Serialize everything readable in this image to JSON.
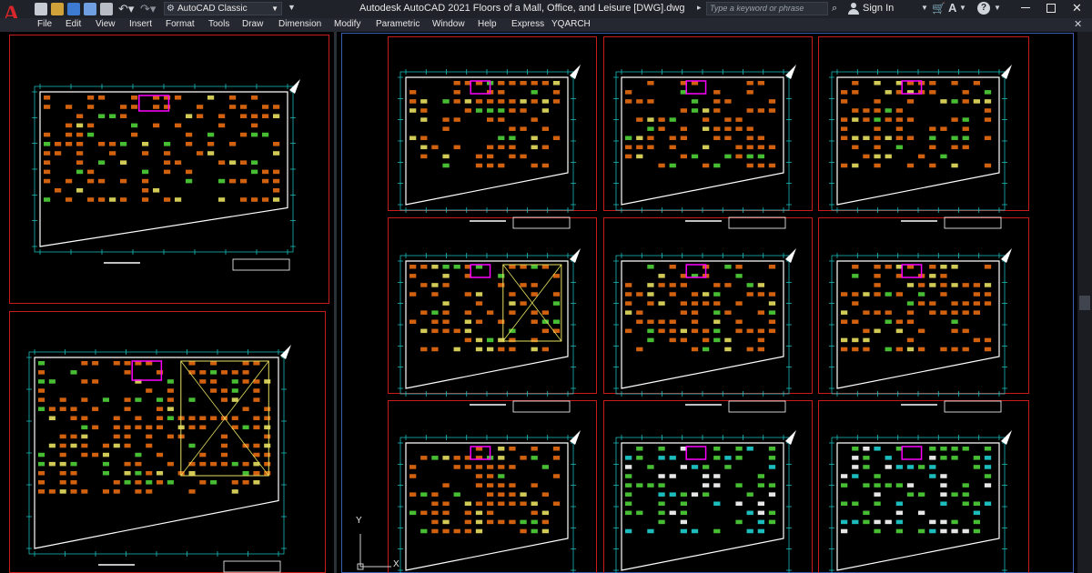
{
  "titlebar": {
    "app_logo": "A",
    "workspace": "AutoCAD Classic",
    "title": "Autodesk AutoCAD 2021    Floors of a Mall, Office, and Leisure [DWG].dwg",
    "search_placeholder": "Type a keyword or phrase",
    "signin_label": "Sign In",
    "icons": [
      "new-icon",
      "open-icon",
      "save-icon",
      "saveas-icon",
      "print-icon",
      "undo-icon",
      "redo-icon",
      "search-icon",
      "user-icon",
      "cart-icon",
      "a360-icon",
      "help-icon",
      "minimize-icon",
      "maximize-icon",
      "close-icon"
    ]
  },
  "menu": {
    "items": [
      "File",
      "Edit",
      "View",
      "Insert",
      "Format",
      "Tools",
      "Draw",
      "Dimension",
      "Modify",
      "Parametric",
      "Window",
      "Help",
      "Express",
      "YQARCH"
    ]
  },
  "drawing": {
    "ucs": {
      "y_label": "Y",
      "x_label": "X"
    },
    "colors": {
      "background": "#000000",
      "sheet_border": "#c81c1c",
      "dimension_line": "#1fd0d0",
      "walls": "#ffffff",
      "furniture": "#e86c10",
      "highlight": "#ff00ff",
      "ceiling_lines": "#e8e060",
      "vegetation": "#4fd13a"
    }
  }
}
